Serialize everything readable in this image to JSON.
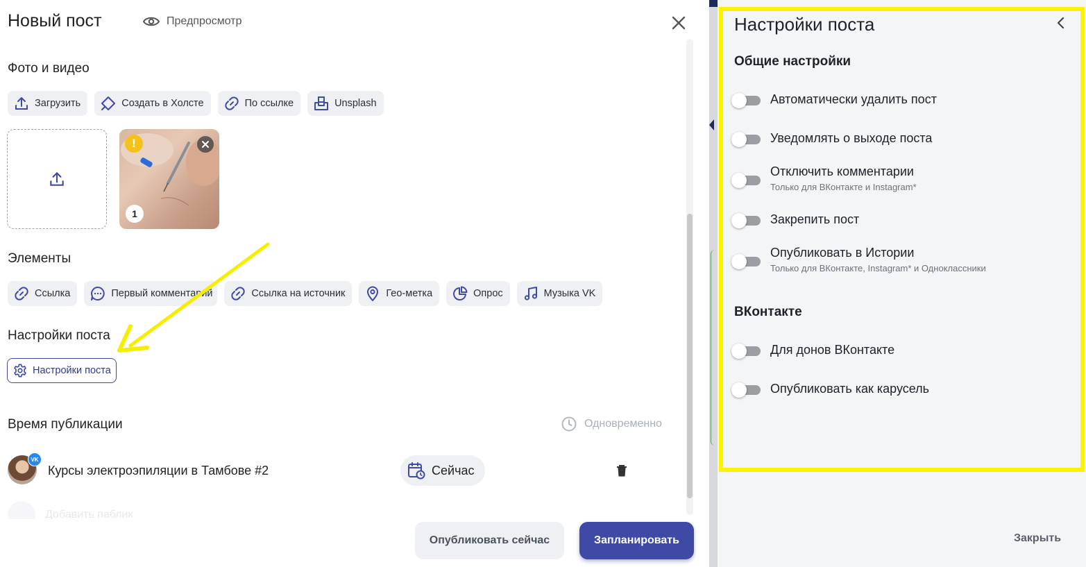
{
  "editor": {
    "title": "Новый пост",
    "preview_label": "Предпросмотр",
    "media": {
      "heading": "Фото и видео",
      "buttons": [
        {
          "label": "Загрузить",
          "icon": "upload-icon"
        },
        {
          "label": "Создать в Холсте",
          "icon": "canvas-icon"
        },
        {
          "label": "По ссылке",
          "icon": "link-icon"
        },
        {
          "label": "Unsplash",
          "icon": "unsplash-icon"
        }
      ],
      "thumbnail": {
        "index": "1",
        "warning": "!"
      }
    },
    "elements": {
      "heading": "Элементы",
      "buttons": [
        {
          "label": "Ссылка",
          "icon": "link-icon"
        },
        {
          "label": "Первый комментарий",
          "icon": "comment-icon"
        },
        {
          "label": "Ссылка на источник",
          "icon": "link-icon"
        },
        {
          "label": "Гео-метка",
          "icon": "location-pin-icon"
        },
        {
          "label": "Опрос",
          "icon": "poll-icon"
        },
        {
          "label": "Музыка VK",
          "icon": "music-note-icon"
        }
      ]
    },
    "post_settings": {
      "heading": "Настройки поста",
      "button_label": "Настройки поста"
    },
    "publish_time": {
      "heading": "Время публикации",
      "simultaneous_label": "Одновременно",
      "account": {
        "name": "Курсы электроэпиляции в Тамбове #2",
        "network_badge": "VK",
        "time_label": "Сейчас"
      },
      "add_public_label": "Добавить паблик"
    },
    "footer": {
      "publish_now_label": "Опубликовать сейчас",
      "schedule_label": "Запланировать"
    }
  },
  "side_panel": {
    "title": "Настройки поста",
    "general": {
      "heading": "Общие настройки",
      "options": [
        {
          "label": "Автоматически удалить пост",
          "sub": "",
          "enabled": false
        },
        {
          "label": "Уведомлять о выходе поста",
          "sub": "",
          "enabled": false
        },
        {
          "label": "Отключить комментарии",
          "sub": "Только для ВКонтакте и Instagram*",
          "enabled": false
        },
        {
          "label": "Закрепить пост",
          "sub": "",
          "enabled": false
        },
        {
          "label": "Опубликовать в Истории",
          "sub": "Только для ВКонтакте, Instagram* и Одноклассники",
          "enabled": false
        }
      ]
    },
    "vk": {
      "heading": "ВКонтакте",
      "options": [
        {
          "label": "Для донов ВКонтакте",
          "sub": "",
          "enabled": false
        },
        {
          "label": "Опубликовать как карусель",
          "sub": "",
          "enabled": false
        }
      ]
    },
    "close_label": "Закрыть"
  },
  "colors": {
    "accent": "#3f4aa6",
    "highlight": "#fff200",
    "annotation_arrow": "#f4ee00",
    "vk_badge": "#2787f5",
    "warning": "#f5c21b"
  }
}
